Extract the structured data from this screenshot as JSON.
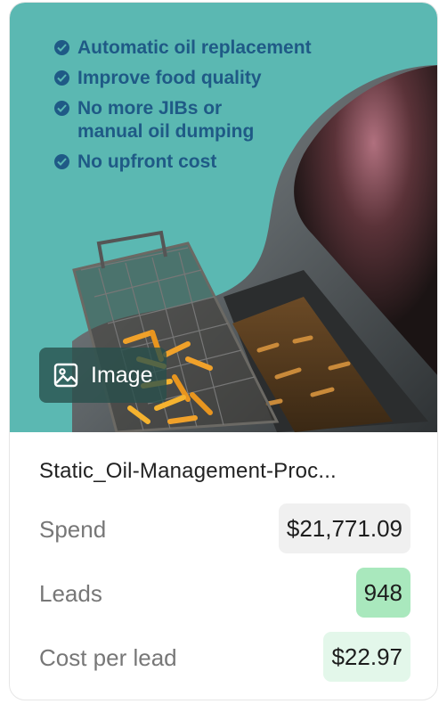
{
  "creative": {
    "bullets": [
      "Automatic oil replacement",
      "Improve food quality",
      "No more JIBs or manual oil dumping",
      "No upfront cost"
    ],
    "type_chip_label": "Image",
    "type_chip_icon": "image-icon",
    "title": "Static_Oil-Management-Proc..."
  },
  "metrics": [
    {
      "label": "Spend",
      "value": "$21,771.09",
      "badge_color": "#f0f0f0"
    },
    {
      "label": "Leads",
      "value": "948",
      "badge_color": "#a9e8bd"
    },
    {
      "label": "Cost per lead",
      "value": "$22.97",
      "badge_color": "#e3f7ea"
    }
  ],
  "colors": {
    "banner_background": "#5bb8b2",
    "bullet_text": "#1f5a86"
  }
}
